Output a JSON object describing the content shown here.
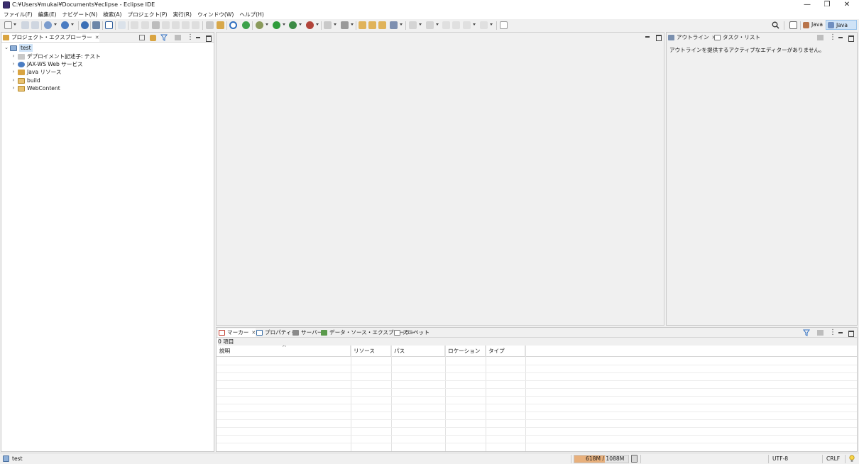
{
  "window": {
    "title": "C:¥Users¥mukai¥Documents¥eclipse - Eclipse IDE",
    "minimize_glyph": "—",
    "restore_glyph": "❐",
    "close_glyph": "✕"
  },
  "menu": [
    "ファイル(F)",
    "編集(E)",
    "ナビゲート(N)",
    "検索(A)",
    "プロジェクト(P)",
    "実行(R)",
    "ウィンドウ(W)",
    "ヘルプ(H)"
  ],
  "perspectives": {
    "java": "Java",
    "javaee": "Java EE"
  },
  "project_explorer": {
    "tab_label": "プロジェクト・エクスプローラー",
    "close_glyph": "✕",
    "tree": {
      "root": "test",
      "children": [
        "デプロイメント記述子: テスト",
        "JAX-WS Web サービス",
        "Java リソース",
        "build",
        "WebContent"
      ]
    }
  },
  "outline": {
    "tab_label": "アウトライン",
    "close_glyph": "✕",
    "tasks_tab_label": "タスク・リスト",
    "message": "アウトラインを提供するアクティブなエディターがありません。"
  },
  "bottom_panel": {
    "tabs": [
      "マーカー",
      "プロパティー",
      "サーバー",
      "データ・ソース・エクスプローラー",
      "スニペット"
    ],
    "close_glyph": "✕",
    "item_count": "0 項目",
    "sort_glyph": "^",
    "columns": [
      "説明",
      "リソース",
      "パス",
      "ロケーション",
      "タイプ"
    ]
  },
  "status": {
    "selection": "test",
    "memory": "618M / 1088M",
    "memory_fraction": 0.568,
    "encoding": "UTF-8",
    "line_ending": "CRLF"
  },
  "colors": {
    "accent_blue": "#2f6fc2",
    "selected_tab": "#cfe3f7",
    "memory_fill": "#e8b07c"
  }
}
